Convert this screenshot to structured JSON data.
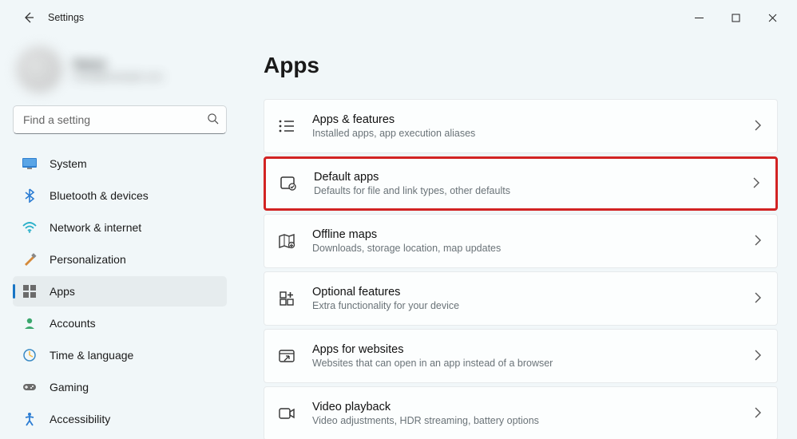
{
  "window": {
    "title": "Settings"
  },
  "profile": {
    "name": "Name",
    "sub": "email@example.com"
  },
  "search": {
    "placeholder": "Find a setting"
  },
  "sidebar": {
    "items": [
      {
        "label": "System"
      },
      {
        "label": "Bluetooth & devices"
      },
      {
        "label": "Network & internet"
      },
      {
        "label": "Personalization"
      },
      {
        "label": "Apps"
      },
      {
        "label": "Accounts"
      },
      {
        "label": "Time & language"
      },
      {
        "label": "Gaming"
      },
      {
        "label": "Accessibility"
      }
    ]
  },
  "page": {
    "title": "Apps"
  },
  "cards": [
    {
      "title": "Apps & features",
      "sub": "Installed apps, app execution aliases"
    },
    {
      "title": "Default apps",
      "sub": "Defaults for file and link types, other defaults"
    },
    {
      "title": "Offline maps",
      "sub": "Downloads, storage location, map updates"
    },
    {
      "title": "Optional features",
      "sub": "Extra functionality for your device"
    },
    {
      "title": "Apps for websites",
      "sub": "Websites that can open in an app instead of a browser"
    },
    {
      "title": "Video playback",
      "sub": "Video adjustments, HDR streaming, battery options"
    }
  ]
}
